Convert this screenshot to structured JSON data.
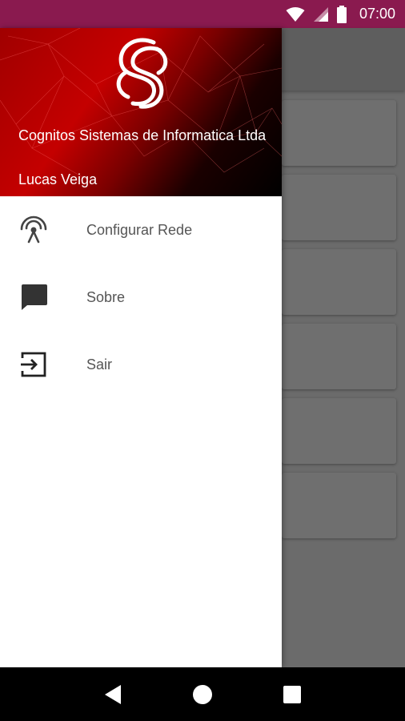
{
  "status_bar": {
    "time": "07:00",
    "icons": [
      "wifi-icon",
      "signal-icon",
      "battery-icon"
    ],
    "color": "#8a1a4f"
  },
  "drawer": {
    "header": {
      "company": "Cognitos Sistemas de Informatica Ltda",
      "user": "Lucas Veiga",
      "logo": "cognitos-logo"
    },
    "items": [
      {
        "label": "Configurar Rede",
        "icon": "antenna-icon"
      },
      {
        "label": "Sobre",
        "icon": "chat-icon"
      },
      {
        "label": "Sair",
        "icon": "exit-icon"
      }
    ]
  },
  "nav_bar": {
    "buttons": [
      "back-icon",
      "home-icon",
      "recents-icon"
    ]
  }
}
